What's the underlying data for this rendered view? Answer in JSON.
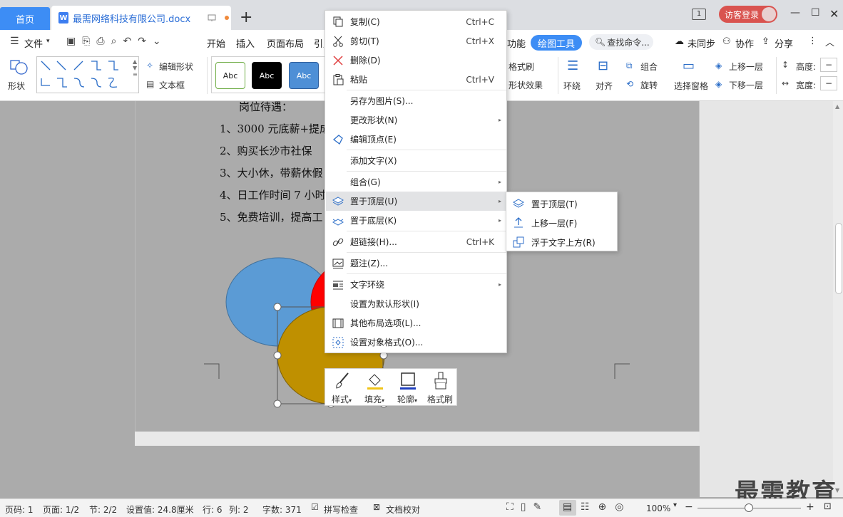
{
  "tabs": {
    "home": "首页",
    "doc": "最需网络科技有限公司.docx",
    "add": "+"
  },
  "titlebar": {
    "page_indicator": "1",
    "login": "访客登录"
  },
  "menubar": {
    "file": "文件",
    "items": [
      "开始",
      "插入",
      "页面布局",
      "引用"
    ],
    "feature": "功能",
    "draw_tools": "绘图工具",
    "search": "查找命令...",
    "unsynced": "未同步",
    "collab": "协作",
    "share": "分享"
  },
  "ribbon": {
    "shape": "形状",
    "edit_shape": "编辑形状",
    "textbox": "文本框",
    "style_samples": [
      "Abc",
      "Abc",
      "Abc"
    ],
    "format_painter": "格式刷",
    "shape_effect": "形状效果",
    "wrap": "环绕",
    "align": "对齐",
    "group": "组合",
    "rotate": "旋转",
    "select_pane": "选择窗格",
    "bring_forward": "上移一层",
    "send_backward": "下移一层",
    "height": "高度:",
    "width": "宽度:"
  },
  "document": {
    "lines": [
      "岗位待遇：",
      "1、3000 元底薪+提成",
      "2、购买长沙市社保",
      "3、大小休，带薪休假",
      "4、日工作时间 7 小时",
      "5、免费培训，提高工"
    ]
  },
  "context_menu": {
    "items": [
      {
        "label": "复制(C)",
        "shortcut": "Ctrl+C",
        "icon": "copy-icon"
      },
      {
        "label": "剪切(T)",
        "shortcut": "Ctrl+X",
        "icon": "cut-icon"
      },
      {
        "label": "删除(D)",
        "shortcut": "",
        "icon": "delete-icon"
      },
      {
        "label": "粘贴",
        "shortcut": "Ctrl+V",
        "icon": "paste-icon"
      },
      {
        "label": "另存为图片(S)...",
        "shortcut": "",
        "icon": ""
      },
      {
        "label": "更改形状(N)",
        "shortcut": "",
        "icon": ""
      },
      {
        "label": "编辑顶点(E)",
        "shortcut": "",
        "icon": "edit-points-icon"
      },
      {
        "label": "添加文字(X)",
        "shortcut": "",
        "icon": ""
      },
      {
        "label": "组合(G)",
        "shortcut": "",
        "icon": ""
      },
      {
        "label": "置于顶层(U)",
        "shortcut": "",
        "icon": "bring-to-front-icon"
      },
      {
        "label": "置于底层(K)",
        "shortcut": "",
        "icon": "send-to-back-icon"
      },
      {
        "label": "超链接(H)...",
        "shortcut": "Ctrl+K",
        "icon": "link-icon"
      },
      {
        "label": "题注(Z)...",
        "shortcut": "",
        "icon": "caption-icon"
      },
      {
        "label": "文字环绕",
        "shortcut": "",
        "icon": "text-wrap-icon"
      },
      {
        "label": "设置为默认形状(I)",
        "shortcut": "",
        "icon": ""
      },
      {
        "label": "其他布局选项(L)...",
        "shortcut": "",
        "icon": "layout-options-icon"
      },
      {
        "label": "设置对象格式(O)...",
        "shortcut": "",
        "icon": "format-object-icon"
      }
    ]
  },
  "submenu": {
    "items": [
      "置于顶层(T)",
      "上移一层(F)",
      "浮于文字上方(R)"
    ]
  },
  "float_toolbar": {
    "items": [
      "样式",
      "填充",
      "轮廓",
      "格式刷"
    ]
  },
  "statusbar": {
    "page_no": "页码: 1",
    "pages": "页面: 1/2",
    "section": "节: 2/2",
    "setting": "设置值: 24.8厘米",
    "row": "行: 6",
    "col": "列: 2",
    "words": "字数: 371",
    "spell": "拼写检查",
    "proof": "文档校对",
    "zoom": "100%"
  },
  "watermark": "最需教育",
  "colors": {
    "accent": "#3d8df5",
    "ellipse_blue": "#5b9bd5",
    "ellipse_red": "#ff0000",
    "ellipse_gold": "#bf9000",
    "page_gray": "#ababab"
  }
}
